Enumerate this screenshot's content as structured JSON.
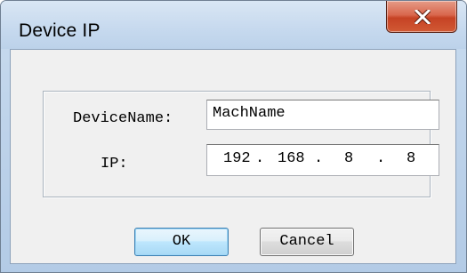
{
  "window": {
    "title": "Device IP",
    "close_icon": "close-icon"
  },
  "form": {
    "device_name_label": "DeviceName:",
    "device_name_value": "MachName",
    "ip_label": "IP:",
    "ip_octets": [
      "192",
      "168",
      "8",
      "8"
    ],
    "ip_separator": "."
  },
  "buttons": {
    "ok_label": "OK",
    "cancel_label": "Cancel"
  },
  "colors": {
    "title_bar": "#c6d9ee",
    "close_button": "#c64224",
    "client_background": "#f0f0f0",
    "ok_button_accent": "#3c7fb1"
  }
}
